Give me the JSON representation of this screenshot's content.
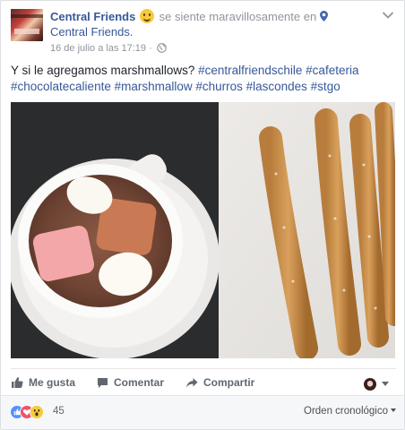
{
  "post": {
    "page_name": "Central Friends",
    "feeling_text": "se siente maravillosamente en",
    "location": "Central Friends.",
    "date": "16 de julio a las 17:19",
    "separator": "·",
    "text": "Y si le agregamos marshmallows?",
    "hashtags": "#centralfriendschile #cafeteria #chocolatecaliente #marshmallow #churros #lascondes #stgo"
  },
  "icons": {
    "feeling": "smiling-face-icon",
    "location": "map-pin-icon",
    "audience": "globe-icon",
    "menu": "chevron-down-icon",
    "like": "thumbs-up-icon",
    "comment": "speech-bubble-icon",
    "share": "share-arrow-icon"
  },
  "actions": {
    "like_label": "Me gusta",
    "comment_label": "Comentar",
    "share_label": "Compartir"
  },
  "reactions": {
    "types": [
      "like",
      "love",
      "wow"
    ],
    "count": "45"
  },
  "comments": {
    "order_label": "Orden cronológico"
  },
  "colors": {
    "link": "#365899",
    "meta": "#90949c",
    "text": "#1d2129",
    "like": "#5890ff",
    "love": "#f25268",
    "wow": "#f7c93e"
  }
}
